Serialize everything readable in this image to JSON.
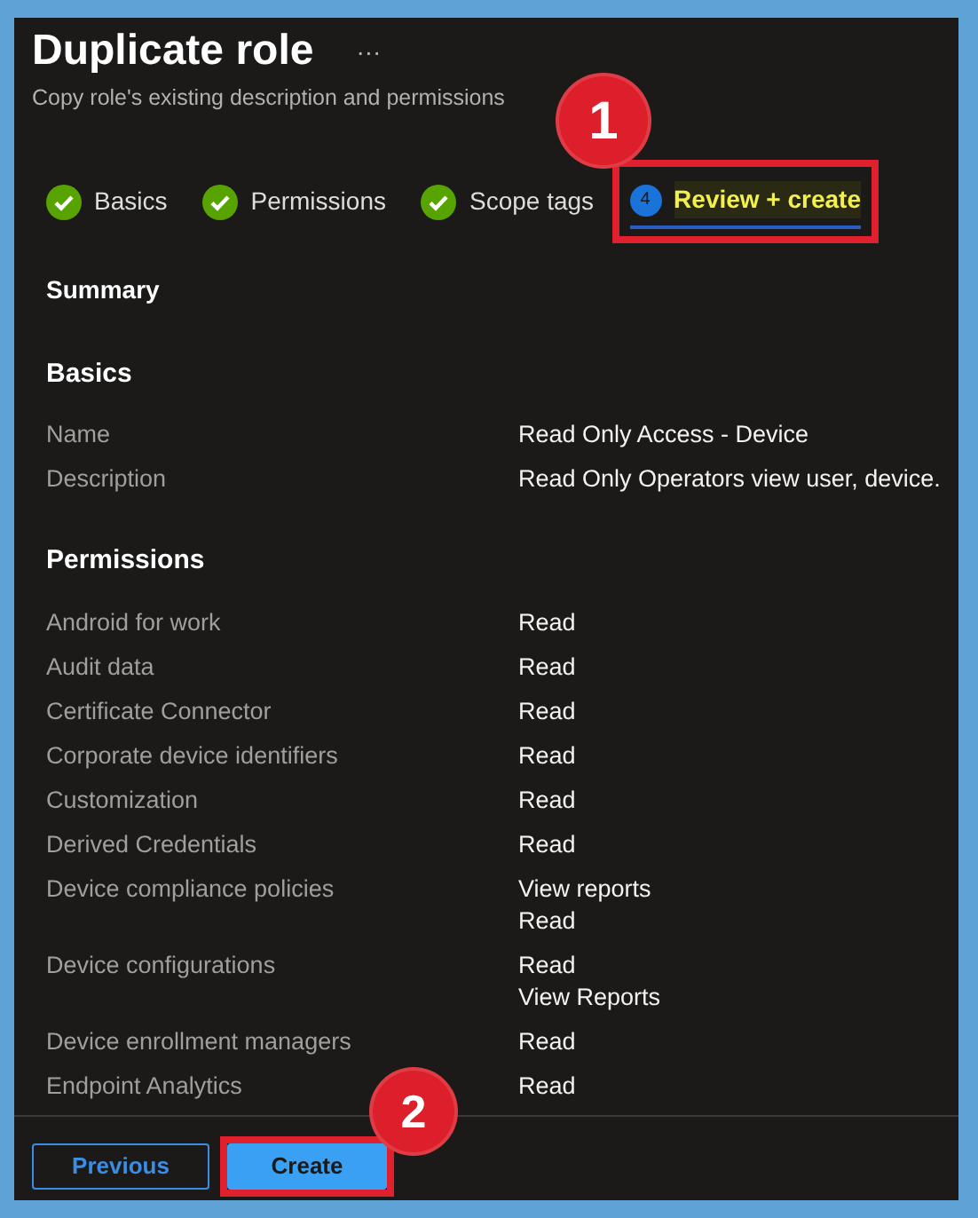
{
  "window": {
    "title": "Duplicate role",
    "more": "···",
    "subtitle": "Copy role's existing description and permissions"
  },
  "steps": [
    {
      "label": "Basics",
      "completed": true,
      "selected": false
    },
    {
      "label": "Permissions",
      "completed": true,
      "selected": false
    },
    {
      "label": "Scope tags",
      "completed": true,
      "selected": false
    },
    {
      "label": "Review + create",
      "completed": false,
      "selected": true,
      "number": "4"
    }
  ],
  "summary_title": "Summary",
  "sections": [
    {
      "heading": "Basics",
      "rows": [
        {
          "label": "Name",
          "values": [
            "Read Only Access - Device"
          ]
        },
        {
          "label": "Description",
          "values": [
            "Read Only Operators view user, device."
          ]
        }
      ]
    },
    {
      "heading": "Permissions",
      "rows": [
        {
          "label": "Android for work",
          "values": [
            "Read"
          ]
        },
        {
          "label": "Audit data",
          "values": [
            "Read"
          ]
        },
        {
          "label": "Certificate Connector",
          "values": [
            "Read"
          ]
        },
        {
          "label": "Corporate device identifiers",
          "values": [
            "Read"
          ]
        },
        {
          "label": "Customization",
          "values": [
            "Read"
          ]
        },
        {
          "label": "Derived Credentials",
          "values": [
            "Read"
          ]
        },
        {
          "label": "Device compliance policies",
          "values": [
            "View reports",
            "Read"
          ]
        },
        {
          "label": "Device configurations",
          "values": [
            "Read",
            "View Reports"
          ]
        },
        {
          "label": "Device enrollment managers",
          "values": [
            "Read"
          ]
        },
        {
          "label": "Endpoint Analytics",
          "values": [
            "Read"
          ]
        }
      ]
    }
  ],
  "footer_buttons": [
    {
      "label": "Previous",
      "kind": "secondary"
    },
    {
      "label": "Create",
      "kind": "primary"
    }
  ],
  "callouts": [
    {
      "number": "1"
    },
    {
      "number": "2"
    }
  ]
}
